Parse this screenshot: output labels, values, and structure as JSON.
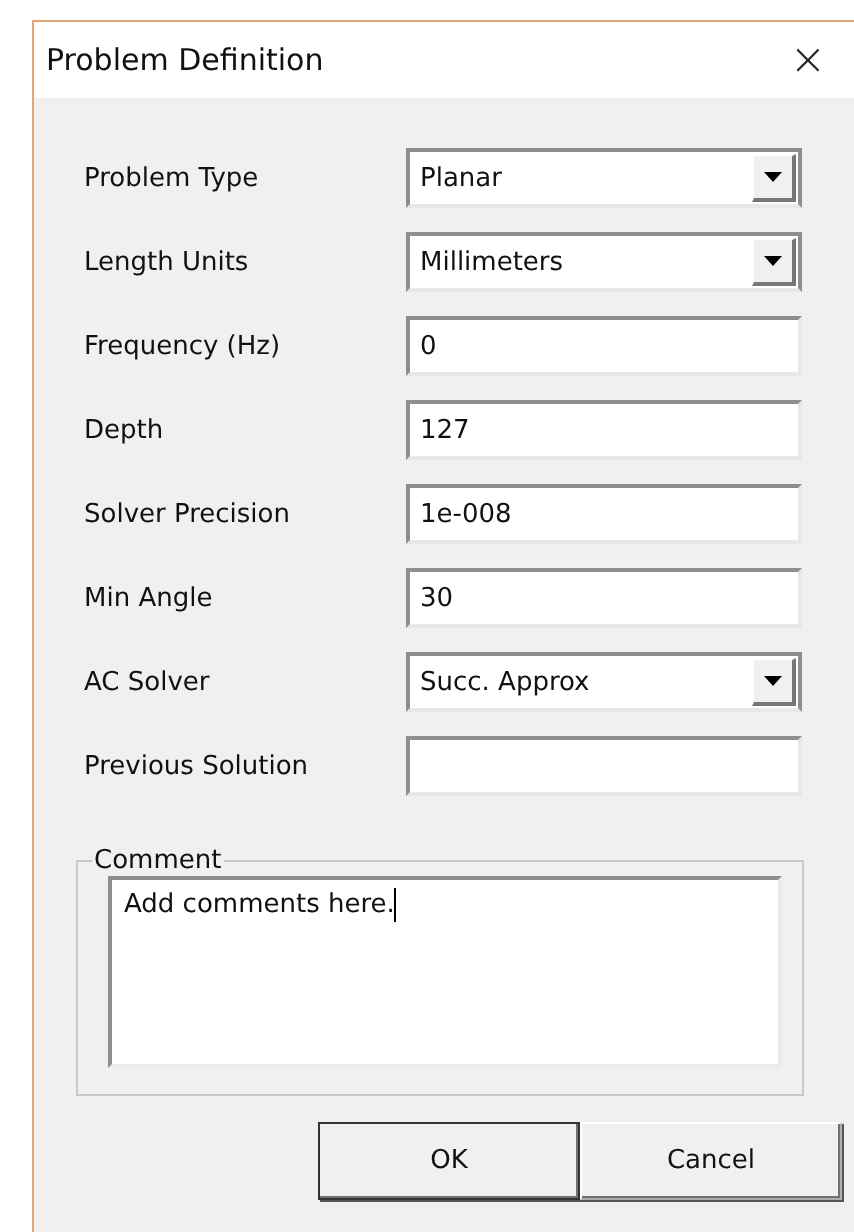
{
  "window": {
    "title": "Problem Definition",
    "close": "×"
  },
  "fields": [
    {
      "label": "Problem Type",
      "kind": "dropdown",
      "value": "Planar"
    },
    {
      "label": "Length Units",
      "kind": "dropdown",
      "value": "Millimeters"
    },
    {
      "label": "Frequency (Hz)",
      "kind": "text",
      "value": "0"
    },
    {
      "label": "Depth",
      "kind": "text",
      "value": "127"
    },
    {
      "label": "Solver Precision",
      "kind": "text",
      "value": "1e-008"
    },
    {
      "label": "Min Angle",
      "kind": "text",
      "value": "30"
    },
    {
      "label": "AC Solver",
      "kind": "dropdown",
      "value": "Succ. Approx"
    },
    {
      "label": "Previous Solution",
      "kind": "text"
    }
  ],
  "comment": {
    "legend": "Comment",
    "value": "Add comments here."
  },
  "buttons": [
    "OK",
    "Cancel"
  ]
}
